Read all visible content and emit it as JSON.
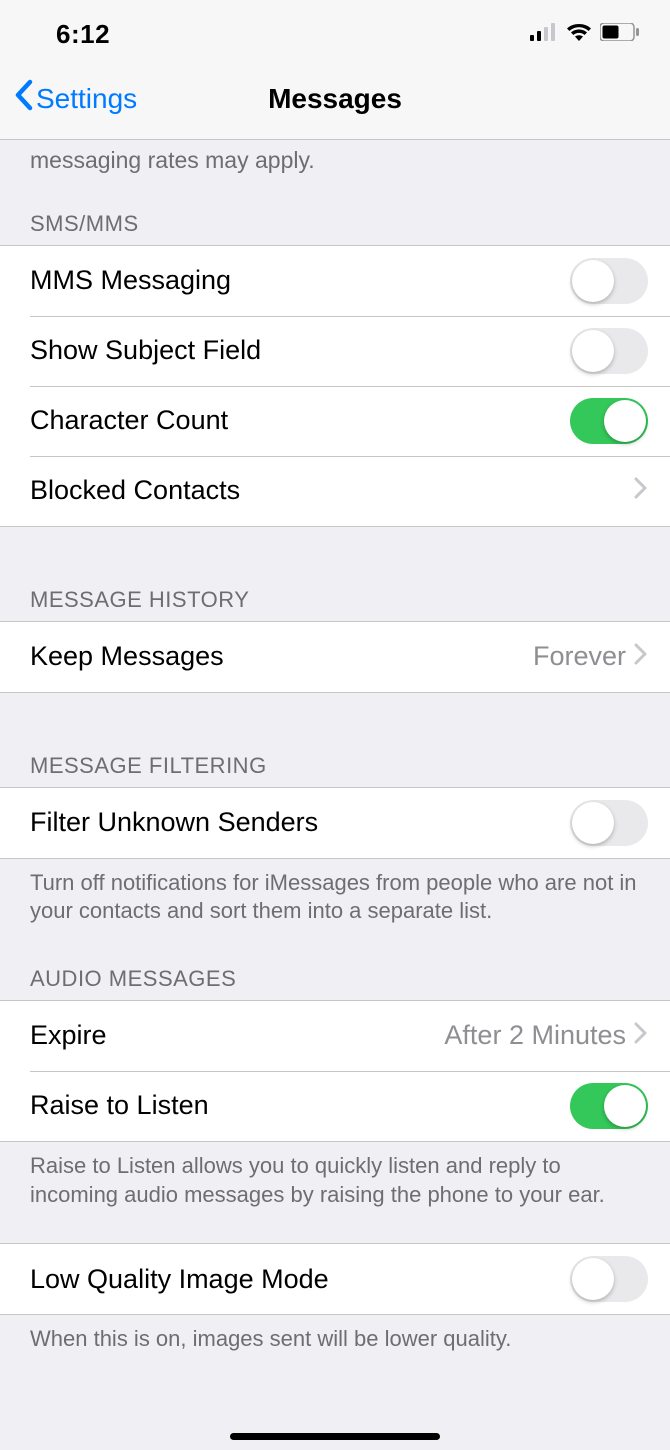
{
  "status": {
    "time": "6:12"
  },
  "nav": {
    "back": "Settings",
    "title": "Messages"
  },
  "truncated_text": "messaging rates may apply.",
  "sections": {
    "smsmms": {
      "header": "SMS/MMS",
      "rows": {
        "mms": {
          "label": "MMS Messaging",
          "on": false
        },
        "subject": {
          "label": "Show Subject Field",
          "on": false
        },
        "charcount": {
          "label": "Character Count",
          "on": true
        },
        "blocked": {
          "label": "Blocked Contacts"
        }
      }
    },
    "history": {
      "header": "MESSAGE HISTORY",
      "rows": {
        "keep": {
          "label": "Keep Messages",
          "value": "Forever"
        }
      }
    },
    "filtering": {
      "header": "MESSAGE FILTERING",
      "rows": {
        "filter": {
          "label": "Filter Unknown Senders",
          "on": false
        }
      },
      "footer": "Turn off notifications for iMessages from people who are not in your contacts and sort them into a separate list."
    },
    "audio": {
      "header": "AUDIO MESSAGES",
      "rows": {
        "expire": {
          "label": "Expire",
          "value": "After 2 Minutes"
        },
        "raise": {
          "label": "Raise to Listen",
          "on": true
        }
      },
      "footer": "Raise to Listen allows you to quickly listen and reply to incoming audio messages by raising the phone to your ear."
    },
    "lowq": {
      "rows": {
        "lowq": {
          "label": "Low Quality Image Mode",
          "on": false
        }
      },
      "footer": "When this is on, images sent will be lower quality."
    }
  }
}
